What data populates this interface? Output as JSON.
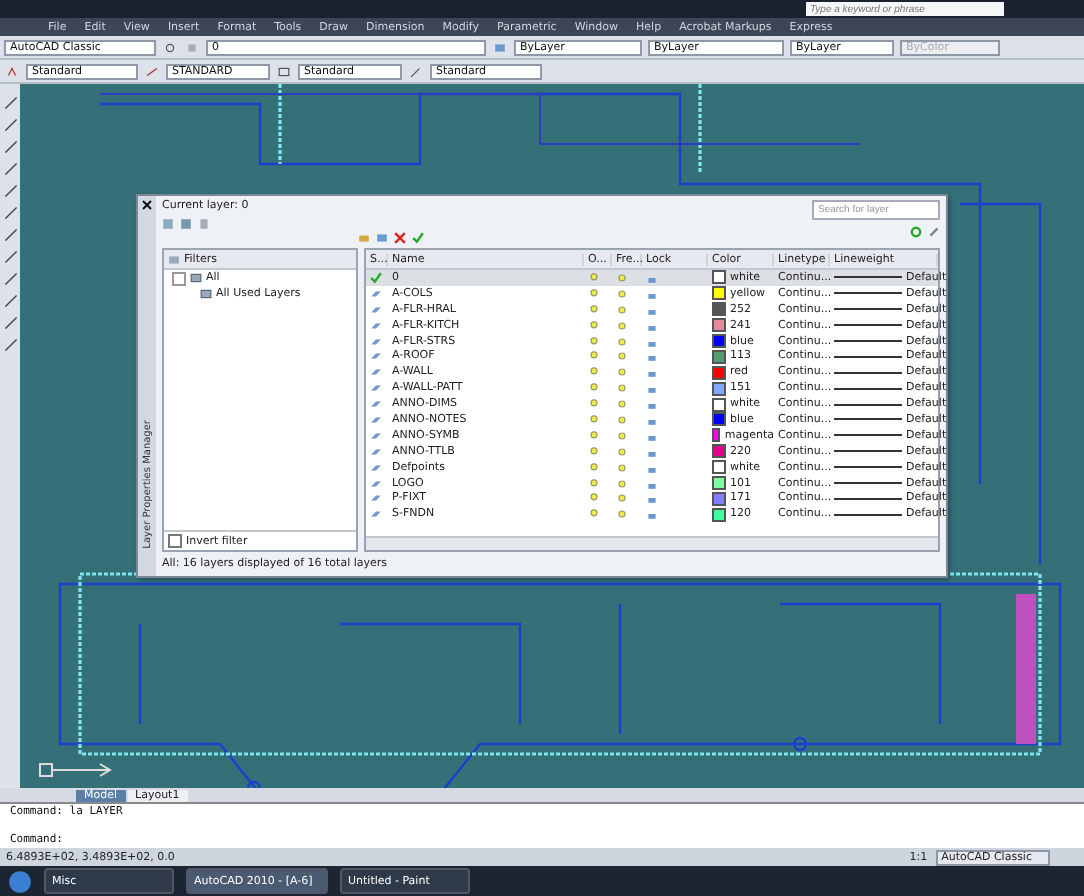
{
  "title_bar": {
    "search": {
      "placeholder": "Type a keyword or phrase"
    }
  },
  "menu": [
    "File",
    "Edit",
    "View",
    "Insert",
    "Format",
    "Tools",
    "Draw",
    "Dimension",
    "Modify",
    "Parametric",
    "Window",
    "Help",
    "Acrobat Markups",
    "Express"
  ],
  "toolbar_1": {
    "workspace": "AutoCAD Classic",
    "layer": "0",
    "color_control": "ByLayer",
    "linetype": "ByLayer",
    "lineweight": "ByLayer",
    "plot_style": {
      "value": "ByColor",
      "disabled": true
    }
  },
  "toolbar_2": {
    "text_style": "Standard",
    "dim_style": "STANDARD",
    "table_style": "Standard",
    "multileader_style": "Standard"
  },
  "layer_dialog": {
    "side_title": "Layer Properties Manager",
    "current_layer": "Current layer: 0",
    "search": {
      "placeholder": "Search for layer"
    },
    "filters": {
      "header": "Filters",
      "tree": [
        {
          "label": "All",
          "expanded": true,
          "children": [
            {
              "label": "All Used Layers"
            }
          ]
        }
      ],
      "invert_filter": {
        "label": "Invert filter",
        "checked": false
      }
    },
    "columns": [
      "S...",
      "Name",
      "O...",
      "Fre...",
      "Lock",
      "Color",
      "Linetype",
      "Lineweight"
    ],
    "rows": [
      {
        "name": "0",
        "current": true,
        "selected": true,
        "color_name": "white",
        "color": "#ffffff",
        "linetype": "Continu...",
        "lineweight": "Default"
      },
      {
        "name": "A-COLS",
        "current": false,
        "selected": false,
        "color_name": "yellow",
        "color": "#ffff00",
        "linetype": "Continu...",
        "lineweight": "Default"
      },
      {
        "name": "A-FLR-HRAL",
        "current": false,
        "selected": false,
        "color_name": "252",
        "color": "#555555",
        "linetype": "Continu...",
        "lineweight": "Default"
      },
      {
        "name": "A-FLR-KITCH",
        "current": false,
        "selected": false,
        "color_name": "241",
        "color": "#e08aa0",
        "linetype": "Continu...",
        "lineweight": "Default"
      },
      {
        "name": "A-FLR-STRS",
        "current": false,
        "selected": false,
        "color_name": "blue",
        "color": "#0000ff",
        "linetype": "Continu...",
        "lineweight": "Default"
      },
      {
        "name": "A-ROOF",
        "current": false,
        "selected": false,
        "color_name": "113",
        "color": "#4f9f6f",
        "linetype": "Continu...",
        "lineweight": "Default"
      },
      {
        "name": "A-WALL",
        "current": false,
        "selected": false,
        "color_name": "red",
        "color": "#ff0000",
        "linetype": "Continu...",
        "lineweight": "Default"
      },
      {
        "name": "A-WALL-PATT",
        "current": false,
        "selected": false,
        "color_name": "151",
        "color": "#7fa9ff",
        "linetype": "Continu...",
        "lineweight": "Default"
      },
      {
        "name": "ANNO-DIMS",
        "current": false,
        "selected": false,
        "color_name": "white",
        "color": "#ffffff",
        "linetype": "Continu...",
        "lineweight": "Default"
      },
      {
        "name": "ANNO-NOTES",
        "current": false,
        "selected": false,
        "color_name": "blue",
        "color": "#0000ff",
        "linetype": "Continu...",
        "lineweight": "Default"
      },
      {
        "name": "ANNO-SYMB",
        "current": false,
        "selected": false,
        "color_name": "magenta",
        "color": "#ff00ff",
        "linetype": "Continu...",
        "lineweight": "Default"
      },
      {
        "name": "ANNO-TTLB",
        "current": false,
        "selected": false,
        "color_name": "220",
        "color": "#e0008f",
        "linetype": "Continu...",
        "lineweight": "Default"
      },
      {
        "name": "Defpoints",
        "current": false,
        "selected": false,
        "color_name": "white",
        "color": "#ffffff",
        "linetype": "Continu...",
        "lineweight": "Default"
      },
      {
        "name": "LOGO",
        "current": false,
        "selected": false,
        "color_name": "101",
        "color": "#7fff9f",
        "linetype": "Continu...",
        "lineweight": "Default"
      },
      {
        "name": "P-FIXT",
        "current": false,
        "selected": false,
        "color_name": "171",
        "color": "#7f7fff",
        "linetype": "Continu...",
        "lineweight": "Default"
      },
      {
        "name": "S-FNDN",
        "current": false,
        "selected": false,
        "color_name": "120",
        "color": "#3fff9f",
        "linetype": "Continu...",
        "lineweight": "Default"
      }
    ],
    "status": "All: 16 layers displayed of 16 total layers"
  },
  "layout_tabs": [
    {
      "label": "Model",
      "selected": true
    },
    {
      "label": "Layout1",
      "selected": false
    }
  ],
  "command_lines": [
    "Command: la LAYER",
    "Command:"
  ],
  "status_bar": {
    "coordinates": "6.4893E+02, 3.4893E+02, 0.0",
    "scale": "1:1",
    "workspace": "AutoCAD Classic"
  },
  "taskbar": [
    {
      "label": "Misc",
      "selected": false
    },
    {
      "label": "AutoCAD 2010 - [A-6]",
      "selected": true
    },
    {
      "label": "Untitled - Paint",
      "selected": false
    }
  ]
}
